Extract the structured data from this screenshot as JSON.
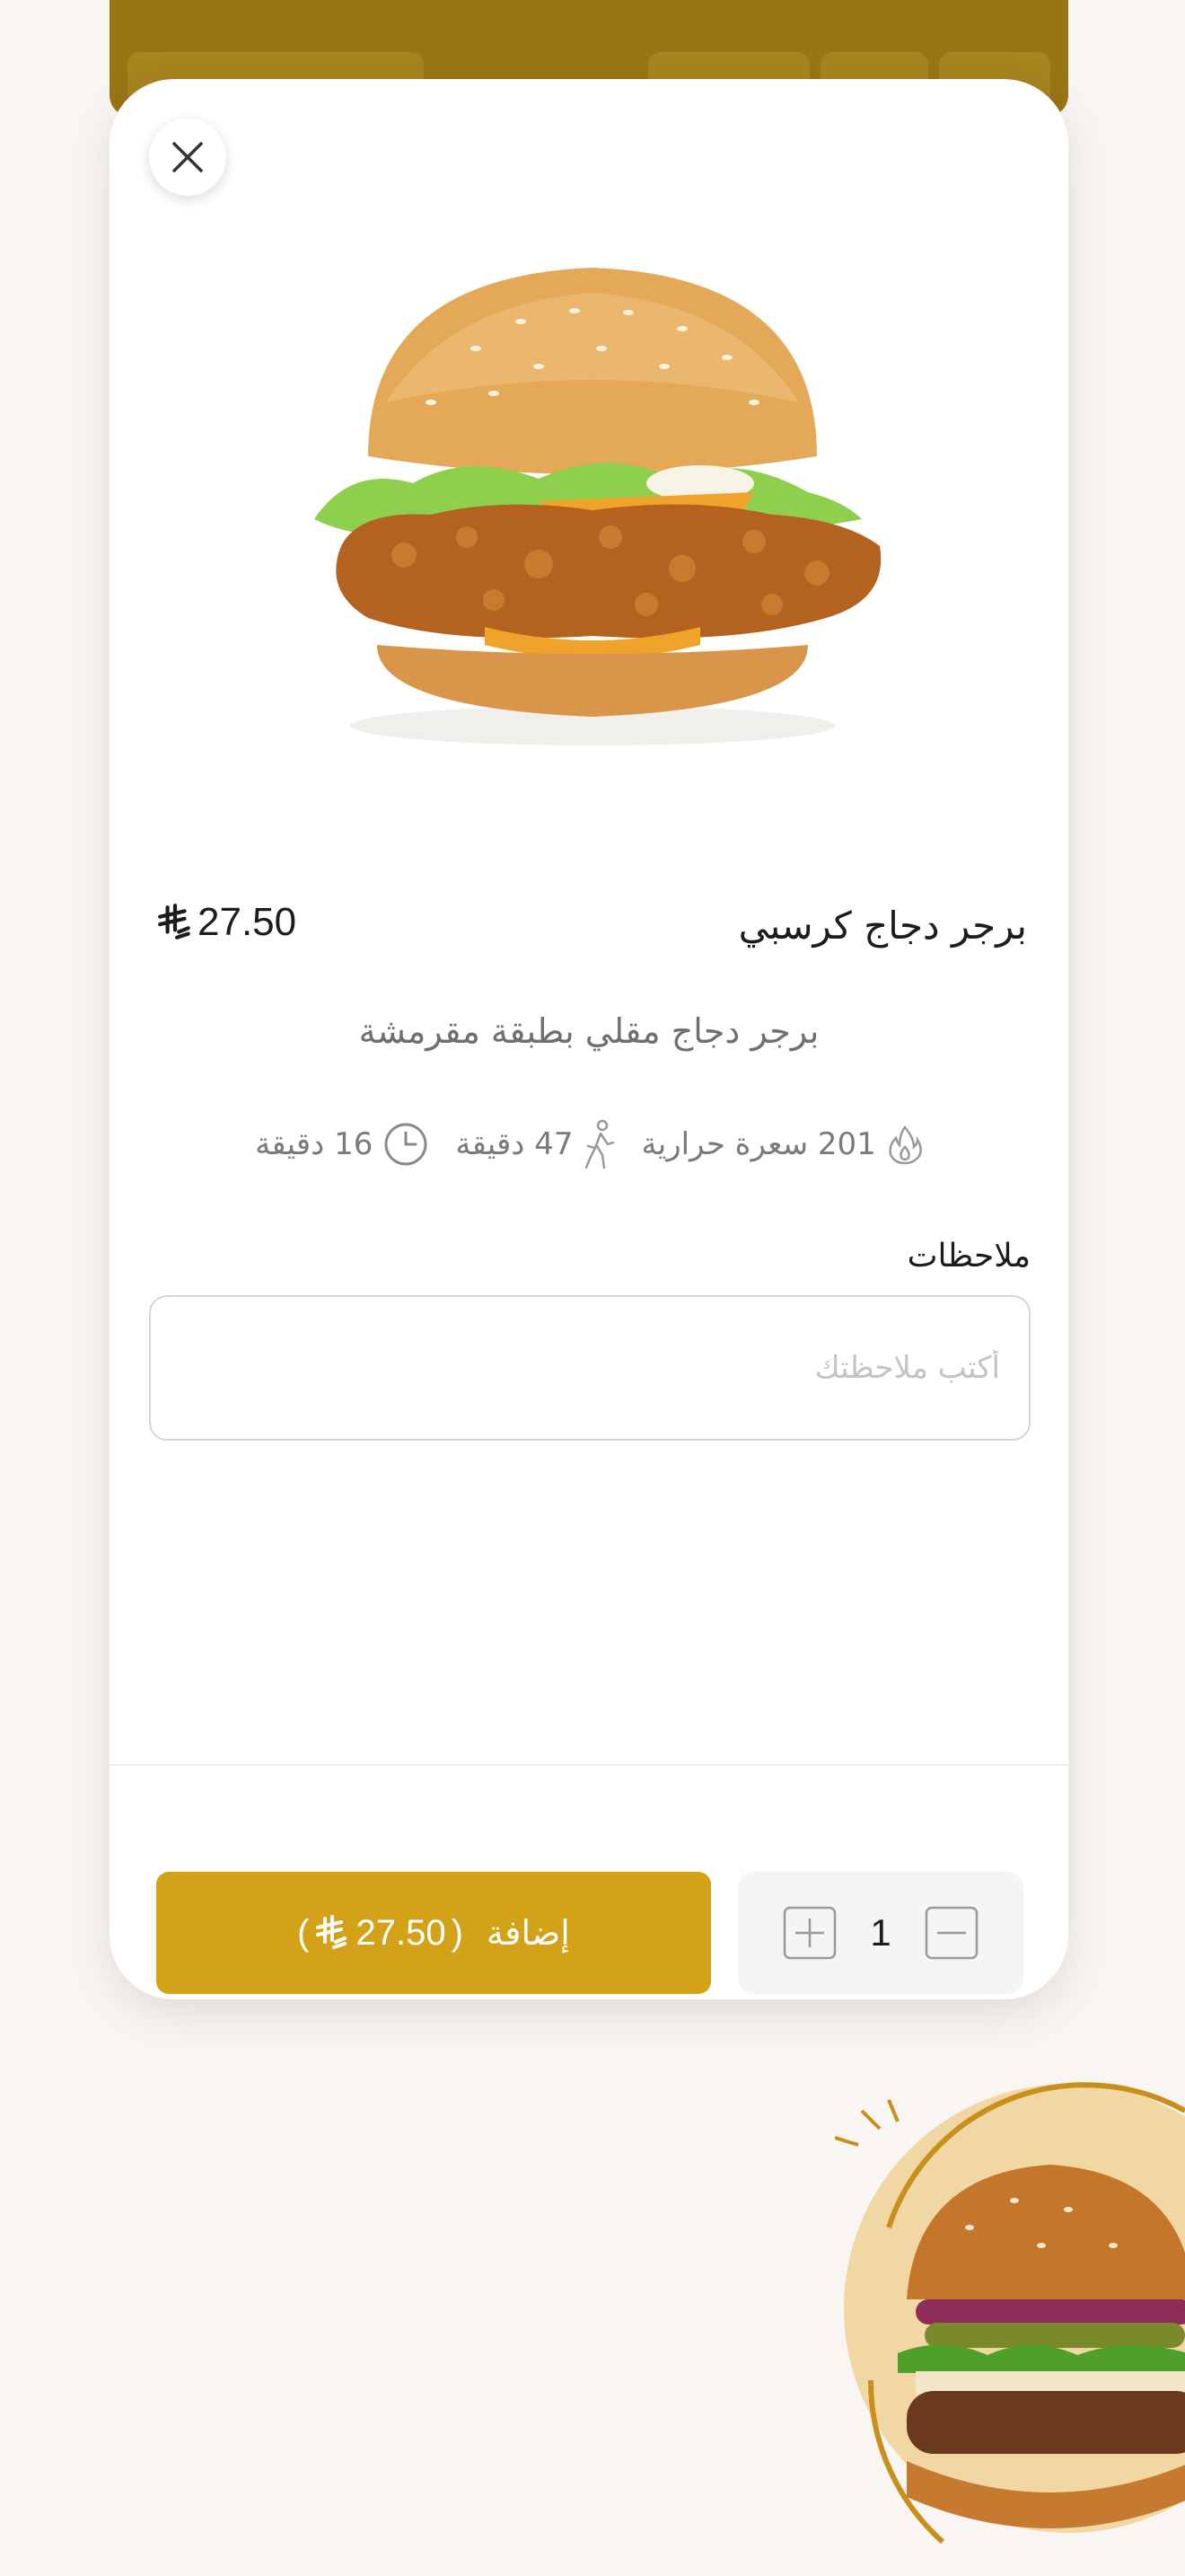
{
  "colors": {
    "accent": "#d4a219",
    "top_bar": "#9a7515",
    "background": "#f8f5f2",
    "sheet": "#ffffff"
  },
  "close_icon": "close-icon",
  "product": {
    "name": "برجر دجاج كرسبي",
    "price": "27.50",
    "currency_icon": "saudi-riyal-icon",
    "description": "برجر دجاج مقلي بطبقة مقرمشة",
    "stats": {
      "calories": "201 سعرة حرارية",
      "walking": "47 دقيقة",
      "prep_time": "16 دقيقة"
    }
  },
  "notes": {
    "label": "ملاحظات",
    "placeholder": "أكتب ملاحظتك"
  },
  "footer": {
    "add_label": "إضافة",
    "add_price": "27.50",
    "quantity": "1"
  }
}
